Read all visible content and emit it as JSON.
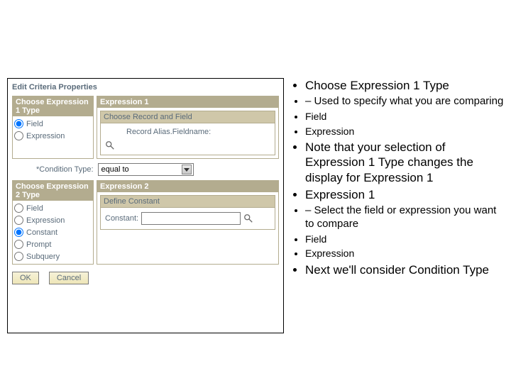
{
  "panel": {
    "title": "Edit Criteria Properties",
    "section1": {
      "type_head": "Choose Expression 1 Type",
      "expr_head": "Expression 1",
      "nested_head": "Choose Record and Field",
      "field_label": "Record Alias.Fieldname:",
      "radios": {
        "field": "Field",
        "expression": "Expression"
      }
    },
    "condition": {
      "label": "*Condition Type:",
      "value": "equal to"
    },
    "section2": {
      "type_head": "Choose Expression 2 Type",
      "expr_head": "Expression 2",
      "nested_head": "Define Constant",
      "constant_label": "Constant:",
      "radios": {
        "field": "Field",
        "expression": "Expression",
        "constant": "Constant",
        "prompt": "Prompt",
        "subquery": "Subquery"
      }
    },
    "buttons": {
      "ok": "OK",
      "cancel": "Cancel"
    }
  },
  "notes": {
    "b1": "Choose Expression 1 Type",
    "b1a": "Used to specify what you are comparing",
    "b1a1": "Field",
    "b1a2": "Expression",
    "b2": "Note that your selection of Expression 1 Type changes the display for Expression 1",
    "b3": "Expression 1",
    "b3a": "Select the field or expression you want to compare",
    "b3a1": "Field",
    "b3a2": "Expression",
    "b4": "Next we'll consider Condition Type"
  }
}
